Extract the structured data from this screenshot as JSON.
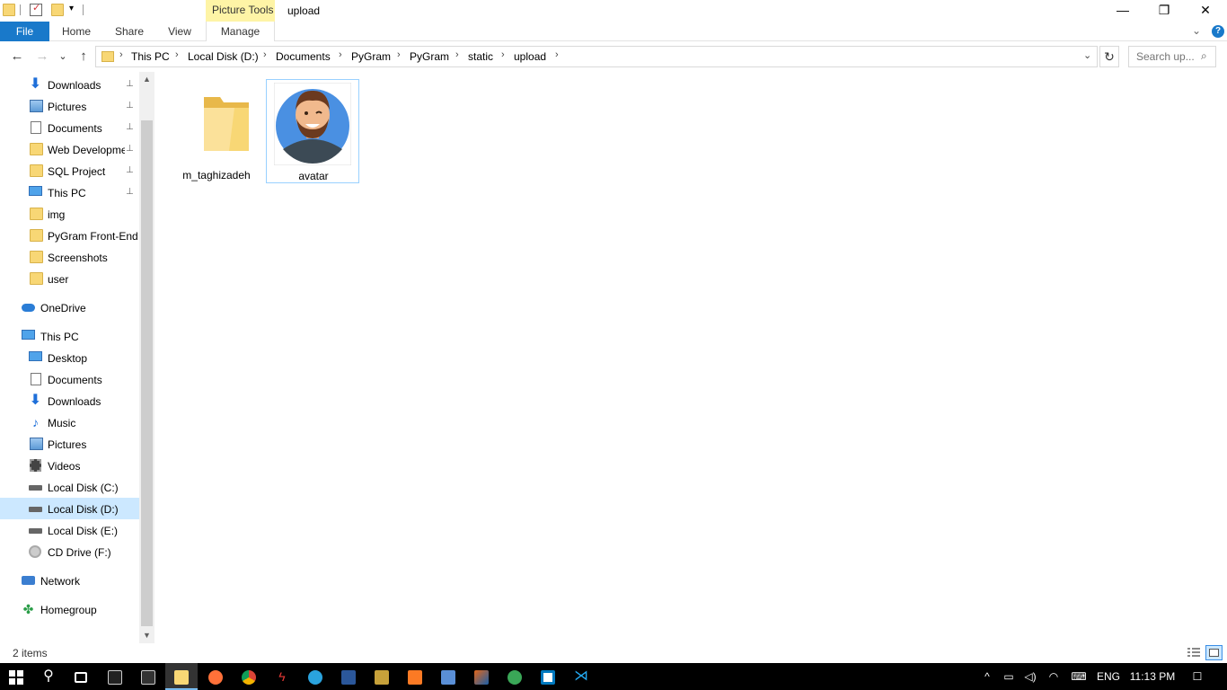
{
  "window": {
    "title": "upload",
    "context_tab_group": "Picture Tools",
    "controls": {
      "minimize": "—",
      "maximize": "❐",
      "close": "✕"
    }
  },
  "ribbon": {
    "tabs": [
      "File",
      "Home",
      "Share",
      "View",
      "Manage"
    ],
    "help": "?",
    "expand": "⌄"
  },
  "navigation": {
    "back": "←",
    "forward": "→",
    "recent": "⌄",
    "up": "↑",
    "breadcrumbs": [
      "This PC",
      "Local Disk (D:)",
      "Documents",
      "PyGram",
      "PyGram",
      "static",
      "upload"
    ],
    "breadcrumb_separator": "›",
    "dropdown": "⌄",
    "refresh": "↻",
    "search_placeholder": "Search up...",
    "search_icon": "⌕"
  },
  "nav_pane": {
    "quick_access": [
      {
        "label": "Downloads",
        "icon": "downloads-icon",
        "pinned": true
      },
      {
        "label": "Pictures",
        "icon": "pictures-icon",
        "pinned": true
      },
      {
        "label": "Documents",
        "icon": "documents-icon",
        "pinned": true
      },
      {
        "label": "Web Developme",
        "icon": "folder-icon",
        "pinned": true
      },
      {
        "label": "SQL Project",
        "icon": "folder-icon",
        "pinned": true
      },
      {
        "label": "This PC",
        "icon": "computer-icon",
        "pinned": true
      },
      {
        "label": "img",
        "icon": "folder-icon",
        "pinned": false
      },
      {
        "label": "PyGram Front-End",
        "icon": "folder-icon",
        "pinned": false
      },
      {
        "label": "Screenshots",
        "icon": "folder-icon",
        "pinned": false
      },
      {
        "label": "user",
        "icon": "folder-icon",
        "pinned": false
      }
    ],
    "onedrive": "OneDrive",
    "this_pc": "This PC",
    "this_pc_items": [
      {
        "label": "Desktop",
        "icon": "desktop-icon"
      },
      {
        "label": "Documents",
        "icon": "documents-icon"
      },
      {
        "label": "Downloads",
        "icon": "downloads-icon"
      },
      {
        "label": "Music",
        "icon": "music-icon"
      },
      {
        "label": "Pictures",
        "icon": "pictures-icon"
      },
      {
        "label": "Videos",
        "icon": "videos-icon"
      },
      {
        "label": "Local Disk (C:)",
        "icon": "drive-icon"
      },
      {
        "label": "Local Disk (D:)",
        "icon": "drive-icon",
        "selected": true
      },
      {
        "label": "Local Disk (E:)",
        "icon": "drive-icon"
      },
      {
        "label": "CD Drive (F:)",
        "icon": "cd-drive-icon"
      }
    ],
    "network": "Network",
    "homegroup": "Homegroup",
    "pin_glyph": "📌"
  },
  "files": [
    {
      "name": "m_taghizadeh",
      "type": "folder"
    },
    {
      "name": "avatar",
      "type": "image",
      "selected": true
    }
  ],
  "status": {
    "item_count": "2 items"
  },
  "taskbar": {
    "language": "ENG",
    "time": "11:13 PM"
  },
  "colors": {
    "accent": "#1979ca",
    "selection": "#cce8ff",
    "selection_border": "#99d1ff",
    "context_tab": "#fef4a6",
    "folder": "#f8d775"
  }
}
